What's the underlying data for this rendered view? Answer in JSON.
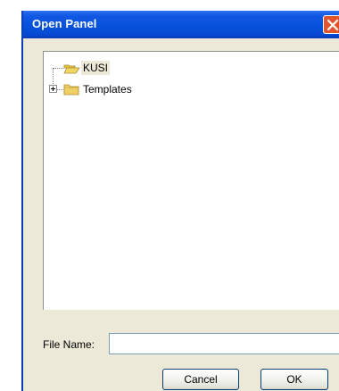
{
  "window": {
    "title": "Open Panel"
  },
  "tree": {
    "items": [
      {
        "label": "KUSI",
        "icon": "open-folder-icon",
        "selected": true
      },
      {
        "label": "Templates",
        "icon": "folder-icon",
        "expandable": true
      }
    ]
  },
  "file_name": {
    "label": "File Name:",
    "value": "",
    "placeholder": ""
  },
  "buttons": {
    "cancel_label": "Cancel",
    "ok_label": "OK"
  },
  "colors": {
    "titlebar": "#0652db",
    "close_button": "#e2542c",
    "dialog_background": "#ece9d8",
    "folder": "#f0d066"
  }
}
